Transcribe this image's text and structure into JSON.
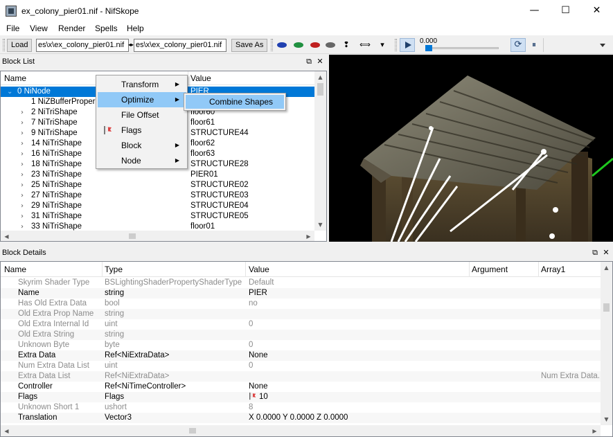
{
  "window": {
    "title": "ex_colony_pier01.nif - NifSkope",
    "minimize": "—",
    "maximize": "☐",
    "close": "✕"
  },
  "menu": [
    "File",
    "View",
    "Render",
    "Spells",
    "Help"
  ],
  "toolbar": {
    "load_label": "Load",
    "load_path": "es\\x\\ex_colony_pier01.nif",
    "save_path": "es\\x\\ex_colony_pier01.nif",
    "save_as_label": "Save As",
    "time_value": "0.000"
  },
  "block_list": {
    "title": "Block List",
    "columns": [
      "Name",
      "Value"
    ],
    "rows": [
      {
        "name": "0 NiNode",
        "value": "PIER",
        "expanded": true,
        "level": 0
      },
      {
        "name": "1 NiZBufferProper",
        "value": "",
        "level": 1
      },
      {
        "name": "2 NiTriShape",
        "value": "floor60",
        "level": 1,
        "collapsed": true
      },
      {
        "name": "7 NiTriShape",
        "value": "floor61",
        "level": 1,
        "collapsed": true
      },
      {
        "name": "9 NiTriShape",
        "value": "STRUCTURE44",
        "level": 1,
        "collapsed": true
      },
      {
        "name": "14 NiTriShape",
        "value": "floor62",
        "level": 1,
        "collapsed": true
      },
      {
        "name": "16 NiTriShape",
        "value": "floor63",
        "level": 1,
        "collapsed": true
      },
      {
        "name": "18 NiTriShape",
        "value": "STRUCTURE28",
        "level": 1,
        "collapsed": true
      },
      {
        "name": "23 NiTriShape",
        "value": "PIER01",
        "level": 1,
        "collapsed": true
      },
      {
        "name": "25 NiTriShape",
        "value": "STRUCTURE02",
        "level": 1,
        "collapsed": true
      },
      {
        "name": "27 NiTriShape",
        "value": "STRUCTURE03",
        "level": 1,
        "collapsed": true
      },
      {
        "name": "29 NiTriShape",
        "value": "STRUCTURE04",
        "level": 1,
        "collapsed": true
      },
      {
        "name": "31 NiTriShape",
        "value": "STRUCTURE05",
        "level": 1,
        "collapsed": true
      },
      {
        "name": "33 NiTriShape",
        "value": "floor01",
        "level": 1,
        "collapsed": true
      }
    ]
  },
  "context_menu": {
    "items": [
      "Transform",
      "Optimize",
      "File Offset",
      "Flags",
      "Block",
      "Node"
    ],
    "submenu_item": "Combine Shapes"
  },
  "block_details": {
    "title": "Block Details",
    "columns": [
      "Name",
      "Type",
      "Value",
      "Argument",
      "Array1"
    ],
    "rows": [
      {
        "name": "Skyrim Shader Type",
        "type": "BSLightingShaderPropertyShaderType",
        "value": "Default",
        "array": "",
        "dim": true
      },
      {
        "name": "Name",
        "type": "string",
        "value": "PIER",
        "array": "",
        "dim": false
      },
      {
        "name": "Has Old Extra Data",
        "type": "bool",
        "value": "no",
        "array": "",
        "dim": true
      },
      {
        "name": "Old Extra Prop Name",
        "type": "string",
        "value": "",
        "array": "",
        "dim": true
      },
      {
        "name": "Old Extra Internal Id",
        "type": "uint",
        "value": "0",
        "array": "",
        "dim": true
      },
      {
        "name": "Old Extra String",
        "type": "string",
        "value": "",
        "array": "",
        "dim": true
      },
      {
        "name": "Unknown Byte",
        "type": "byte",
        "value": "0",
        "array": "",
        "dim": true
      },
      {
        "name": "Extra Data",
        "type": "Ref<NiExtraData>",
        "value": "None",
        "array": "",
        "dim": false
      },
      {
        "name": "Num Extra Data List",
        "type": "uint",
        "value": "0",
        "array": "",
        "dim": true
      },
      {
        "name": "Extra Data List",
        "type": "Ref<NiExtraData>",
        "value": "",
        "array": "Num Extra Data.",
        "dim": true
      },
      {
        "name": "Controller",
        "type": "Ref<NiTimeController>",
        "value": "None",
        "array": "",
        "dim": false
      },
      {
        "name": "Flags",
        "type": "Flags",
        "value": "10",
        "array": "",
        "dim": false,
        "flag": true
      },
      {
        "name": "Unknown Short 1",
        "type": "ushort",
        "value": "8",
        "array": "",
        "dim": true
      },
      {
        "name": "Translation",
        "type": "Vector3",
        "value": "X 0.0000 Y 0.0000 Z 0.0000",
        "array": "",
        "dim": false
      }
    ]
  },
  "colors": {
    "selection": "#0078d7",
    "menu_highlight": "#91c9f7",
    "viewport_bg": "#000000"
  }
}
